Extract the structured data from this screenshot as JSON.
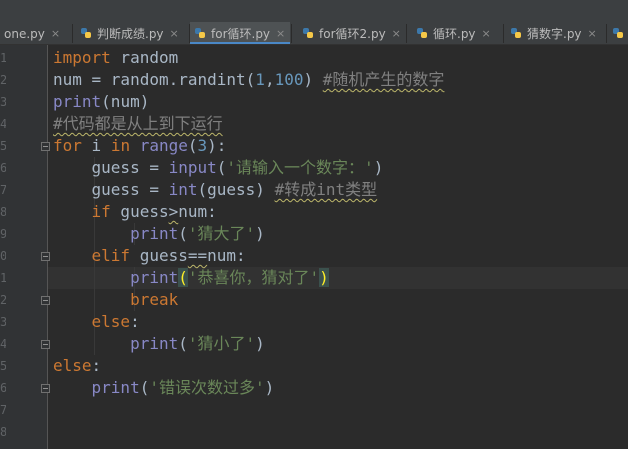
{
  "tabs": [
    {
      "label": "one.py",
      "active": false
    },
    {
      "label": "判断成绩.py",
      "active": false
    },
    {
      "label": "for循环.py",
      "active": true
    },
    {
      "label": "for循环2.py",
      "active": false
    },
    {
      "label": "循环.py",
      "active": false
    },
    {
      "label": "猜数字.py",
      "active": false
    }
  ],
  "tab_close": "×",
  "gutter_numbers": [
    "1",
    "2",
    "3",
    "4",
    "5",
    "6",
    "7",
    "8",
    "9",
    "0",
    "1",
    "2",
    "3",
    "4",
    "5",
    "6",
    "7",
    "8",
    "9"
  ],
  "code": {
    "l1": {
      "kw": "import",
      "rest": " random"
    },
    "l2": {
      "a": "num = random.randint(",
      "n1": "1",
      "sep": ",",
      "n2": "100",
      "b": ") ",
      "cm": "#随机产生的数字"
    },
    "l3": {
      "bi": "print",
      "rest": "(num)"
    },
    "l4": {
      "cm": "#代码都是从上到下运行"
    },
    "l5": {
      "kw1": "for",
      "a": " i ",
      "kw2": "in",
      "sp": " ",
      "bi": "range",
      "o": "(",
      "n": "3",
      "c": "):"
    },
    "l6": {
      "a": "    guess = ",
      "bi": "input",
      "o": "(",
      "s": "'请输入一个数字：'",
      "c": ")"
    },
    "l7": {
      "a": "    guess = ",
      "bi": "int",
      "b": "(guess) ",
      "cm": "#转成int类型"
    },
    "l8": {
      "ind": "    ",
      "kw": "if",
      "a": " guess",
      "op": ">",
      "b": "num:"
    },
    "l9": {
      "ind": "        ",
      "bi": "print",
      "o": "(",
      "s": "'猜大了'",
      "c": ")"
    },
    "l10": {
      "ind": "    ",
      "kw": "elif",
      "a": " guess",
      "op": "==",
      "b": "num:"
    },
    "l11": {
      "ind": "        ",
      "bi": "print",
      "o": "(",
      "s": "'恭喜你，猜对了'",
      "c": ")"
    },
    "l12": {
      "ind": "        ",
      "kw": "break"
    },
    "l13": {
      "ind": "    ",
      "kw": "else",
      "c": ":"
    },
    "l14": {
      "ind": "        ",
      "bi": "print",
      "o": "(",
      "s": "'猜小了'",
      "c": ")"
    },
    "l15": {
      "kw": "else",
      "c": ":"
    },
    "l16": {
      "ind": "    ",
      "bi": "print",
      "o": "(",
      "s": "'错误次数过多'",
      "c": ")"
    }
  }
}
